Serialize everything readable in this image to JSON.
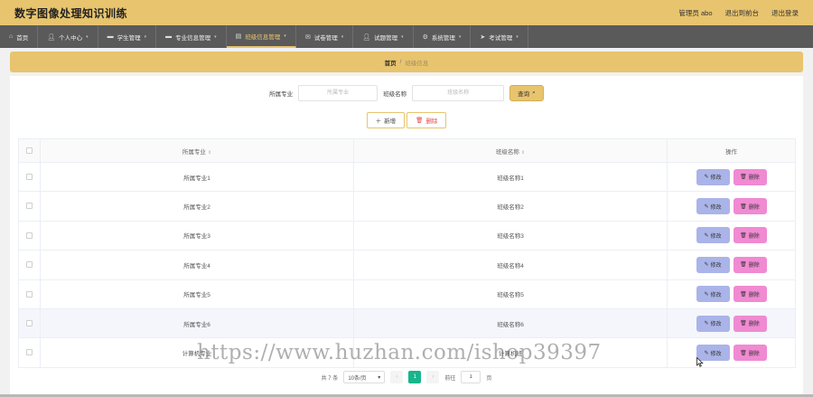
{
  "header": {
    "title": "数字图像处理知识训练",
    "admin_label": "管理员 abo",
    "backend_link": "退出到前台",
    "logout_link": "退出登录"
  },
  "nav": {
    "items": [
      {
        "label": "首页",
        "icon": "home-icon"
      },
      {
        "label": "个人中心",
        "icon": "user-icon"
      },
      {
        "label": "学生管理",
        "icon": "student-icon"
      },
      {
        "label": "专业信息管理",
        "icon": "major-icon"
      },
      {
        "label": "班级信息管理",
        "icon": "class-icon"
      },
      {
        "label": "试卷管理",
        "icon": "mail-icon"
      },
      {
        "label": "试题管理",
        "icon": "user-icon"
      },
      {
        "label": "系统管理",
        "icon": "settings-icon"
      },
      {
        "label": "考试管理",
        "icon": "send-icon"
      }
    ]
  },
  "breadcrumb": {
    "home": "首页",
    "separator": "/",
    "current": "班级信息"
  },
  "search": {
    "major_label": "所属专业",
    "major_placeholder": "所属专业",
    "class_label": "班级名称",
    "class_placeholder": "班级名称",
    "query_button": "查询"
  },
  "actions": {
    "add": "新增",
    "delete": "删除"
  },
  "table": {
    "columns": [
      "所属专业",
      "班级名称",
      "操作"
    ],
    "rows": [
      {
        "major": "所属专业1",
        "class": "班级名称1"
      },
      {
        "major": "所属专业2",
        "class": "班级名称2"
      },
      {
        "major": "所属专业3",
        "class": "班级名称3"
      },
      {
        "major": "所属专业4",
        "class": "班级名称4"
      },
      {
        "major": "所属专业5",
        "class": "班级名称5"
      },
      {
        "major": "所属专业6",
        "class": "班级名称6"
      },
      {
        "major": "计算机专业",
        "class": "计算机班"
      }
    ],
    "edit_label": "修改",
    "delete_label": "删除"
  },
  "pagination": {
    "total_text": "共 7 条",
    "page_size": "10条/页",
    "current_page": "1",
    "goto_label": "前往",
    "goto_value": "1",
    "page_suffix": "页"
  },
  "watermark": "https://www.huzhan.com/ishop39397",
  "colors": {
    "brand": "#e8c46e",
    "nav_bg": "#5a5a5a",
    "edit_btn": "#aab4e8",
    "delete_btn": "#f08ad2",
    "page_active": "#18b58c"
  }
}
